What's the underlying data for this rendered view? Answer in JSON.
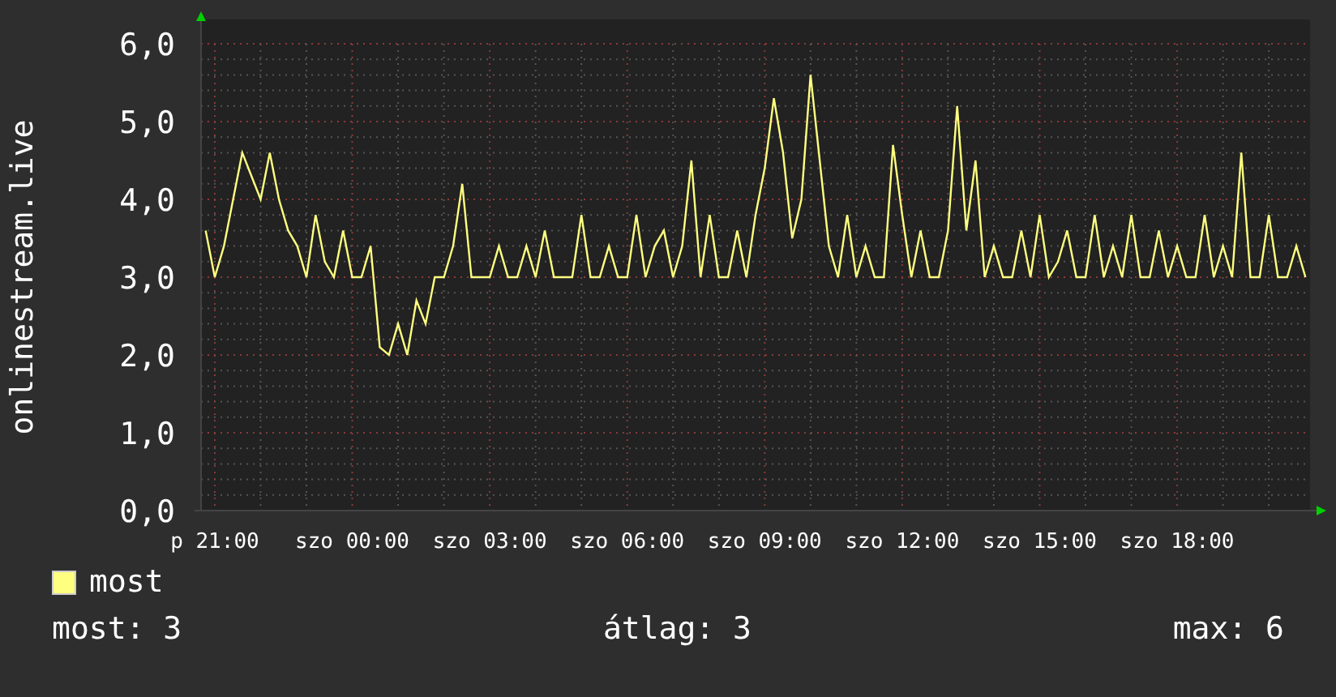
{
  "graph": {
    "chart_data": {
      "type": "line",
      "grid": true,
      "ylabel": "onlinestream.live",
      "ylim": [
        0,
        6
      ],
      "categories": [
        null,
        "p 21:00",
        null,
        null,
        null,
        null,
        null,
        null,
        null,
        null,
        null,
        null,
        null,
        null,
        null,
        null,
        "szo 00:00",
        null,
        null,
        null,
        null,
        null,
        null,
        null,
        null,
        null,
        null,
        null,
        null,
        null,
        null,
        "szo 03:00",
        null,
        null,
        null,
        null,
        null,
        null,
        null,
        null,
        null,
        null,
        null,
        null,
        null,
        null,
        "szo 06:00",
        null,
        null,
        null,
        null,
        null,
        null,
        null,
        null,
        null,
        null,
        null,
        null,
        null,
        null,
        "szo 09:00",
        null,
        null,
        null,
        null,
        null,
        null,
        null,
        null,
        null,
        null,
        null,
        null,
        null,
        null,
        "szo 12:00",
        null,
        null,
        null,
        null,
        null,
        null,
        null,
        null,
        null,
        null,
        null,
        null,
        null,
        null,
        "szo 15:00",
        null,
        null,
        null,
        null,
        null,
        null,
        null,
        null,
        null,
        null,
        null,
        null,
        null,
        null,
        "szo 18:00",
        null,
        null,
        null,
        null,
        null,
        null,
        null,
        null,
        null,
        null,
        null,
        null,
        null,
        null
      ],
      "yticks": [
        {
          "value": 0,
          "label": "0,0"
        },
        {
          "value": 1,
          "label": "1,0"
        },
        {
          "value": 2,
          "label": "2,0"
        },
        {
          "value": 3,
          "label": "3,0"
        },
        {
          "value": 4,
          "label": "4,0"
        },
        {
          "value": 5,
          "label": "5,0"
        },
        {
          "value": 6,
          "label": "6,0"
        }
      ],
      "series": [
        {
          "name": "most",
          "color": "#ffff80",
          "values": [
            3.6,
            3.0,
            3.4,
            4.0,
            4.6,
            4.3,
            4.0,
            4.6,
            4.0,
            3.6,
            3.4,
            3.0,
            3.8,
            3.2,
            3.0,
            3.6,
            3.0,
            3.0,
            3.4,
            2.1,
            2.0,
            2.4,
            2.0,
            2.7,
            2.4,
            3.0,
            3.0,
            3.4,
            4.2,
            3.0,
            3.0,
            3.0,
            3.4,
            3.0,
            3.0,
            3.4,
            3.0,
            3.6,
            3.0,
            3.0,
            3.0,
            3.8,
            3.0,
            3.0,
            3.4,
            3.0,
            3.0,
            3.8,
            3.0,
            3.4,
            3.6,
            3.0,
            3.4,
            4.5,
            3.0,
            3.8,
            3.0,
            3.0,
            3.6,
            3.0,
            3.8,
            4.4,
            5.3,
            4.6,
            3.5,
            4.0,
            5.6,
            4.5,
            3.4,
            3.0,
            3.8,
            3.0,
            3.4,
            3.0,
            3.0,
            4.7,
            3.8,
            3.0,
            3.6,
            3.0,
            3.0,
            3.6,
            5.2,
            3.6,
            4.5,
            3.0,
            3.4,
            3.0,
            3.0,
            3.6,
            3.0,
            3.8,
            3.0,
            3.2,
            3.6,
            3.0,
            3.0,
            3.8,
            3.0,
            3.4,
            3.0,
            3.8,
            3.0,
            3.0,
            3.6,
            3.0,
            3.4,
            3.0,
            3.0,
            3.8,
            3.0,
            3.4,
            3.0,
            4.6,
            3.0,
            3.0,
            3.8,
            3.0,
            3.0,
            3.4,
            3.0
          ]
        }
      ]
    }
  },
  "footer": [
    {
      "text": "most: 3"
    },
    {
      "text": "átlag: 3"
    },
    {
      "text": "max: 6"
    }
  ]
}
